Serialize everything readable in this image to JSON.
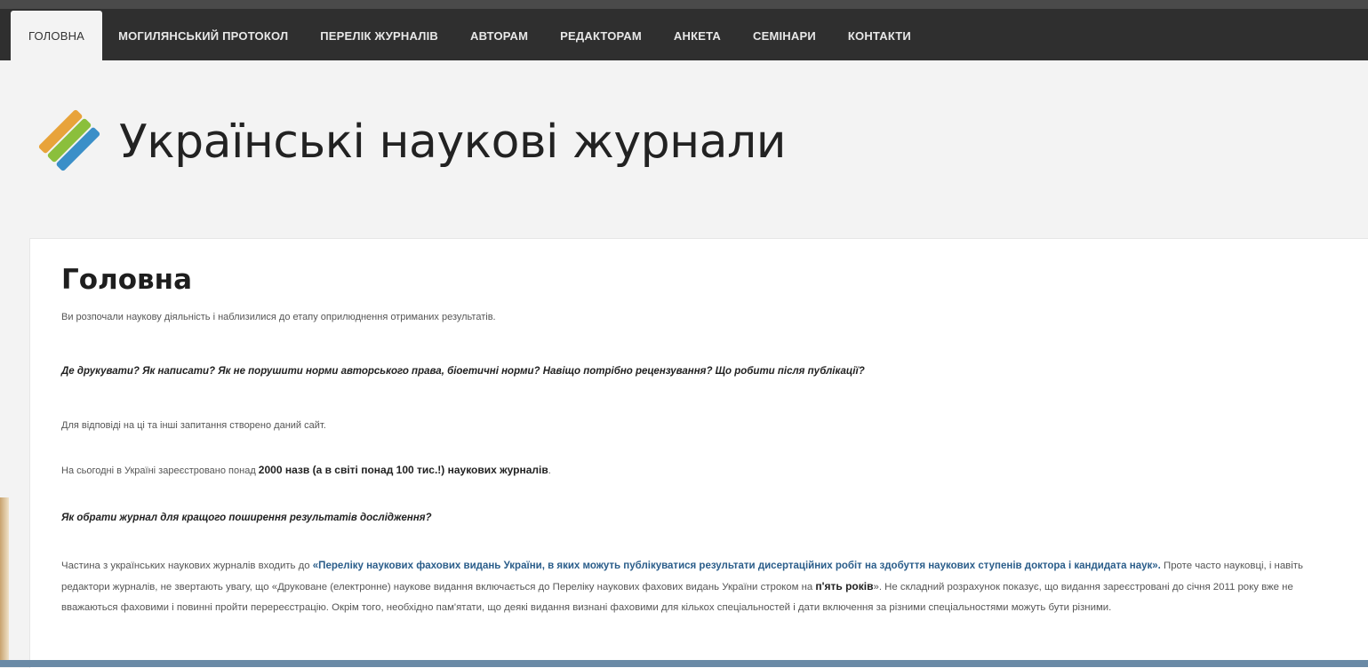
{
  "nav": {
    "items": [
      {
        "label": "ГОЛОВНА",
        "active": true
      },
      {
        "label": "МОГИЛЯНСЬКИЙ ПРОТОКОЛ",
        "active": false
      },
      {
        "label": "ПЕРЕЛІК ЖУРНАЛІВ",
        "active": false
      },
      {
        "label": "АВТОРАМ",
        "active": false
      },
      {
        "label": "РЕДАКТОРАМ",
        "active": false
      },
      {
        "label": "АНКЕТА",
        "active": false
      },
      {
        "label": "СЕМІНАРИ",
        "active": false
      },
      {
        "label": "КОНТАКТИ",
        "active": false
      }
    ]
  },
  "header": {
    "site_title": "Українські наукові журнали",
    "logo_icon": "colored-stripes-logo-icon"
  },
  "main": {
    "title": "Головна",
    "intro": "Ви розпочали наукову діяльність і наблизилися до етапу оприлюднення отриманих результатів.",
    "questions": "Де друкувати? Як написати? Як не порушити норми авторського права, біоетичні норми? Навіщо потрібно рецензування? Що робити після публікації?",
    "answer_line": "Для відповіді на ці та інші запитання створено даний сайт.",
    "stat_prefix": "На сьогодні в Україні зареєстровано понад ",
    "stat_bold": "2000 назв (а в світі понад 100 тис.!) наукових журналів",
    "stat_suffix": ".",
    "choose_question": "Як обрати  журнал для кращого поширення результатів дослідження?",
    "para_prefix": "Частина з українських наукових журналів входить до ",
    "para_link": "«Переліку наукових фахових видань України, в яких можуть публікуватися результати дисертаційних робіт на здобуття наукових ступенів доктора і кандидата наук».",
    "para_mid": " Проте часто науковці, і навіть редактори журналів, не звертають увагу, що «Друковане (електронне) наукове видання включається до Переліку наукових фахових видань України строком на ",
    "para_bold": "п'ять років",
    "para_end": "». Не складний розрахунок показує, що видання зареєстровані до січня 2011 року вже не вважаються фаховими і повинні пройти перереєстрацію. Окрім того, необхідно пам'ятати, що деякі видання визнані фаховими для кількох спеціальностей і дати включення за різними спеціальностями можуть бути різними."
  },
  "colors": {
    "nav_bg": "#2f2f2f",
    "link": "#2a5d8a",
    "logo_orange": "#e8a33a",
    "logo_green": "#8bbf3c",
    "logo_blue": "#3a8fc8"
  }
}
